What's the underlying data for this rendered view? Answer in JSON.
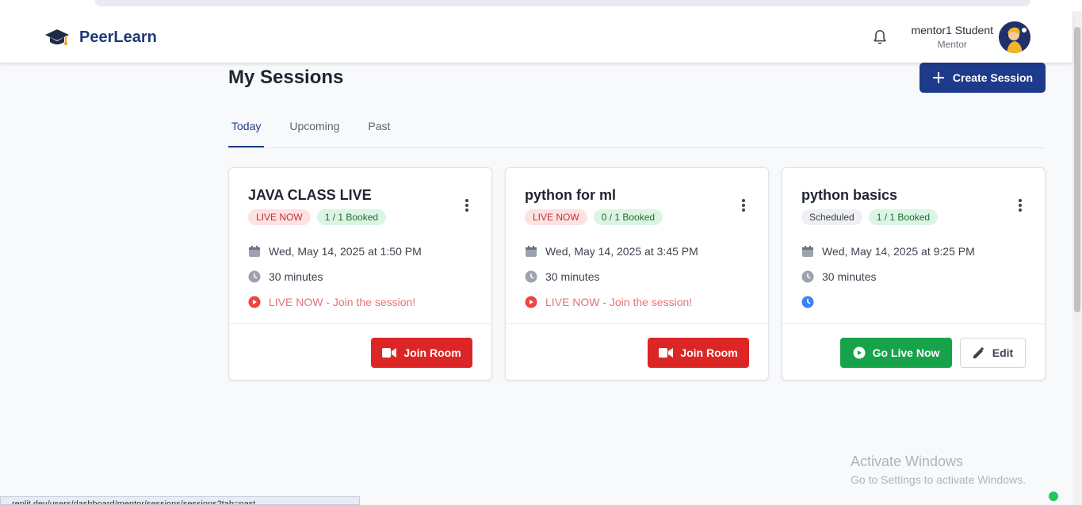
{
  "app": {
    "name": "PeerLearn"
  },
  "user": {
    "name": "mentor1 Student",
    "role": "Mentor"
  },
  "page": {
    "title": "My Sessions",
    "create_button": "Create Session"
  },
  "tabs": [
    {
      "label": "Today",
      "active": true
    },
    {
      "label": "Upcoming",
      "active": false
    },
    {
      "label": "Past",
      "active": false
    }
  ],
  "sessions": [
    {
      "title": "JAVA CLASS LIVE",
      "status_badge": "LIVE NOW",
      "booked_badge": "1 / 1 Booked",
      "datetime": "Wed, May 14, 2025 at 1:50 PM",
      "duration": "30 minutes",
      "status_text": "LIVE NOW - Join the session!",
      "action_label": "Join Room"
    },
    {
      "title": "python for ml",
      "status_badge": "LIVE NOW",
      "booked_badge": "0 / 1 Booked",
      "datetime": "Wed, May 14, 2025 at 3:45 PM",
      "duration": "30 minutes",
      "status_text": "LIVE NOW - Join the session!",
      "action_label": "Join Room"
    },
    {
      "title": "python basics",
      "status_badge": "Scheduled",
      "booked_badge": "1 / 1 Booked",
      "datetime": "Wed, May 14, 2025 at 9:25 PM",
      "duration": "30 minutes",
      "status_text": "",
      "action_label": "Go Live Now",
      "secondary_label": "Edit"
    }
  ],
  "colors": {
    "primary": "#1e3a8a",
    "danger": "#dc2626",
    "success": "#16a34a",
    "live_text": "#e57373"
  },
  "watermark": {
    "line1": "Activate Windows",
    "line2": "Go to Settings to activate Windows."
  },
  "status_bar": {
    "url": "replit.dev/users/dashboard/mentor/sessions/sessions?tab=past"
  }
}
